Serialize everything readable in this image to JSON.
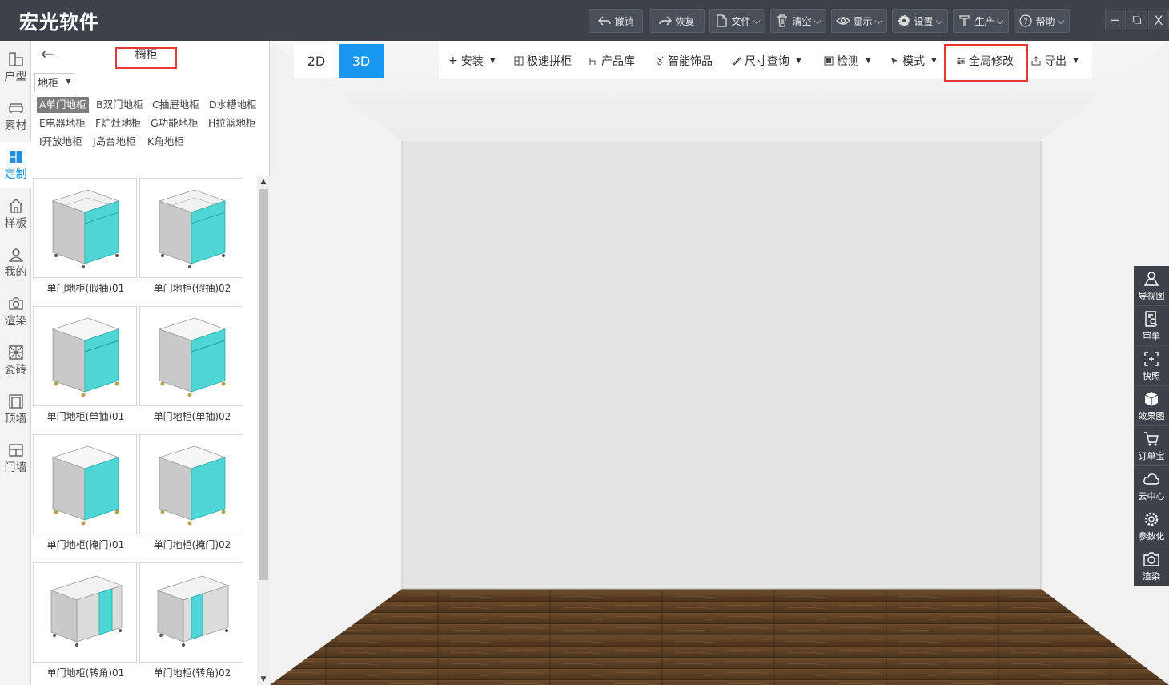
{
  "app": {
    "title": "宏光软件"
  },
  "toolbar": {
    "undo": "撤销",
    "redo": "恢复",
    "file": "文件",
    "clear": "清空",
    "display": "显示",
    "settings": "设置",
    "production": "生产",
    "help": "帮助"
  },
  "window_controls": {
    "minimize": "─",
    "restore": "⧉",
    "close": "X"
  },
  "leftnav": {
    "items": [
      "户型",
      "素材",
      "定制",
      "样板",
      "我的",
      "渲染",
      "瓷砖",
      "顶墙",
      "门墙"
    ],
    "active": "定制"
  },
  "panel": {
    "back": "←",
    "title": "橱柜",
    "select_value": "地柜",
    "categories": [
      "A单门地柜",
      "B双门地柜",
      "C抽屉地柜",
      "D水槽地柜",
      "E电器地柜",
      "F炉灶地柜",
      "G功能地柜",
      "H拉篮地柜",
      "I开放地柜",
      "J岛台地柜",
      "K角地柜"
    ],
    "active_category": "A单门地柜",
    "products": [
      "单门地柜(假抽)01",
      "单门地柜(假抽)02",
      "单门地柜(单抽)01",
      "单门地柜(单抽)02",
      "单门地柜(掩门)01",
      "单门地柜(掩门)02",
      "单门地柜(转角)01",
      "单门地柜(转角)02"
    ]
  },
  "viewport": {
    "view_2d": "2D",
    "view_3d": "3D",
    "active_view": "3D",
    "tools": [
      "安装",
      "极速拼柜",
      "产品库",
      "智能饰品",
      "尺寸查询",
      "检测",
      "模式",
      "全局修改",
      "导出"
    ]
  },
  "floating": {
    "items": [
      "导视图",
      "审单",
      "快照",
      "效果图",
      "订单宝",
      "云中心",
      "参数化",
      "渲染"
    ]
  },
  "colors": {
    "titlebar": "#3d424a",
    "accent": "#1797f0",
    "highlight": "#e53935",
    "door": "#4fd6d6"
  }
}
